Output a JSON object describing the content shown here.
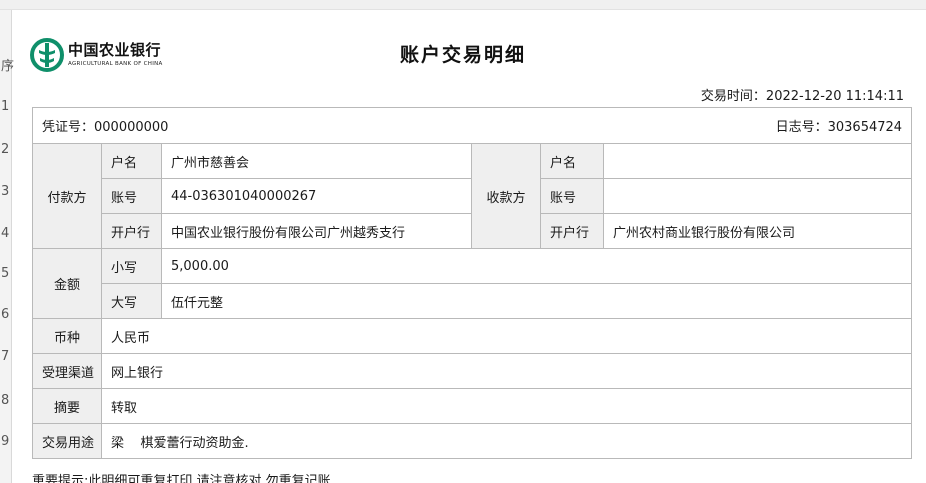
{
  "spreadsheet": {
    "row_numbers": [
      "序",
      "1",
      "2",
      "3",
      "4",
      "5",
      "6",
      "7",
      "8",
      "9"
    ]
  },
  "header": {
    "bank_name_cn": "中国农业银行",
    "bank_name_en": "AGRICULTURAL BANK OF CHINA",
    "logo_icon": "abc-bank-logo-icon",
    "logo_color": "#0f8f6a",
    "title": "账户交易明细",
    "trade_time_label": "交易时间：",
    "trade_time": "2022-12-20 11:14:11"
  },
  "meta": {
    "voucher_label": "凭证号：",
    "voucher_no": "000000000",
    "log_label": "日志号：",
    "log_no": "303654724"
  },
  "payer": {
    "label": "付款方",
    "name_label": "户名",
    "name": "广州市慈善会",
    "account_label": "账号",
    "account": "44-036301040000267",
    "bank_label": "开户行",
    "bank": "中国农业银行股份有限公司广州越秀支行"
  },
  "payee": {
    "label": "收款方",
    "name_label": "户名",
    "name": "",
    "account_label": "账号",
    "account": "",
    "bank_label": "开户行",
    "bank": "广州农村商业银行股份有限公司"
  },
  "amount": {
    "label": "金额",
    "figure_label": "小写",
    "figure": "5,000.00",
    "words_label": "大写",
    "words": "伍仟元整"
  },
  "currency": {
    "label": "币种",
    "value": "人民币"
  },
  "channel": {
    "label": "受理渠道",
    "value": "网上银行"
  },
  "summary": {
    "label": "摘要",
    "value": "转取"
  },
  "purpose": {
    "label": "交易用途",
    "value": "梁    棋爱蕾行动资助金."
  },
  "notice": "重要提示:此明细可重复打印,请注意核对,勿重复记账"
}
